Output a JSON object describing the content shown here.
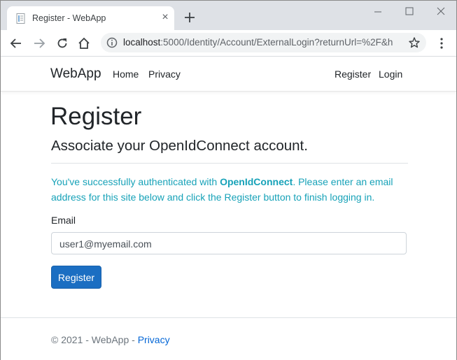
{
  "browser": {
    "tab_title": "Register - WebApp",
    "url_host": "localhost",
    "url_rest": ":5000/Identity/Account/ExternalLogin?returnUrl=%2F&h",
    "new_tab": "+",
    "tab_close": "×"
  },
  "navbar": {
    "brand": "WebApp",
    "links_left": [
      "Home",
      "Privacy"
    ],
    "links_right": [
      "Register",
      "Login"
    ]
  },
  "main": {
    "title": "Register",
    "subtitle": "Associate your OpenIdConnect account.",
    "info_prefix": "You've successfully authenticated with ",
    "info_provider": "OpenIdConnect",
    "info_suffix": ". Please enter an email address for this site below and click the Register button to finish logging in.",
    "email_label": "Email",
    "email_value": "user1@myemail.com",
    "register_button": "Register"
  },
  "footer": {
    "copyright": "© 2021 - WebApp - ",
    "privacy_link": "Privacy"
  },
  "colors": {
    "primary": "#1b6ec2",
    "info": "#17a2b8",
    "link": "#0366d6"
  }
}
